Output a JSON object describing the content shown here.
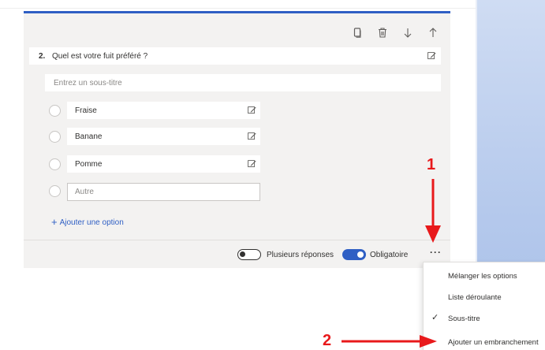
{
  "question": {
    "number": "2.",
    "title": "Quel est votre fuit préféré ?",
    "subtitle_placeholder": "Entrez un sous-titre"
  },
  "options": [
    {
      "label": "Fraise"
    },
    {
      "label": "Banane"
    },
    {
      "label": "Pomme"
    }
  ],
  "other_option": "Autre",
  "add_option": {
    "label": "Ajouter une option"
  },
  "footer": {
    "multiple_answers": {
      "label": "Plusieurs réponses",
      "enabled": false
    },
    "required": {
      "label": "Obligatoire",
      "enabled": true
    },
    "more_label": "···"
  },
  "menu": {
    "items": [
      {
        "label": "Mélanger les options",
        "checked": false
      },
      {
        "label": "Liste déroulante",
        "checked": false
      },
      {
        "label": "Sous-titre",
        "checked": true
      },
      {
        "label": "Ajouter un embranchement",
        "checked": false
      }
    ],
    "check_mark": "✓"
  },
  "annotations": {
    "first": "1",
    "second": "2",
    "color": "#e8191b"
  },
  "colors": {
    "accent": "#2f5fc4",
    "card": "#f3f2f1",
    "panel": "#b5c9ec"
  },
  "icons": [
    "copy-icon",
    "trash-icon",
    "arrow-down-icon",
    "arrow-up-icon",
    "edit-icon",
    "more-icon",
    "check-icon"
  ]
}
